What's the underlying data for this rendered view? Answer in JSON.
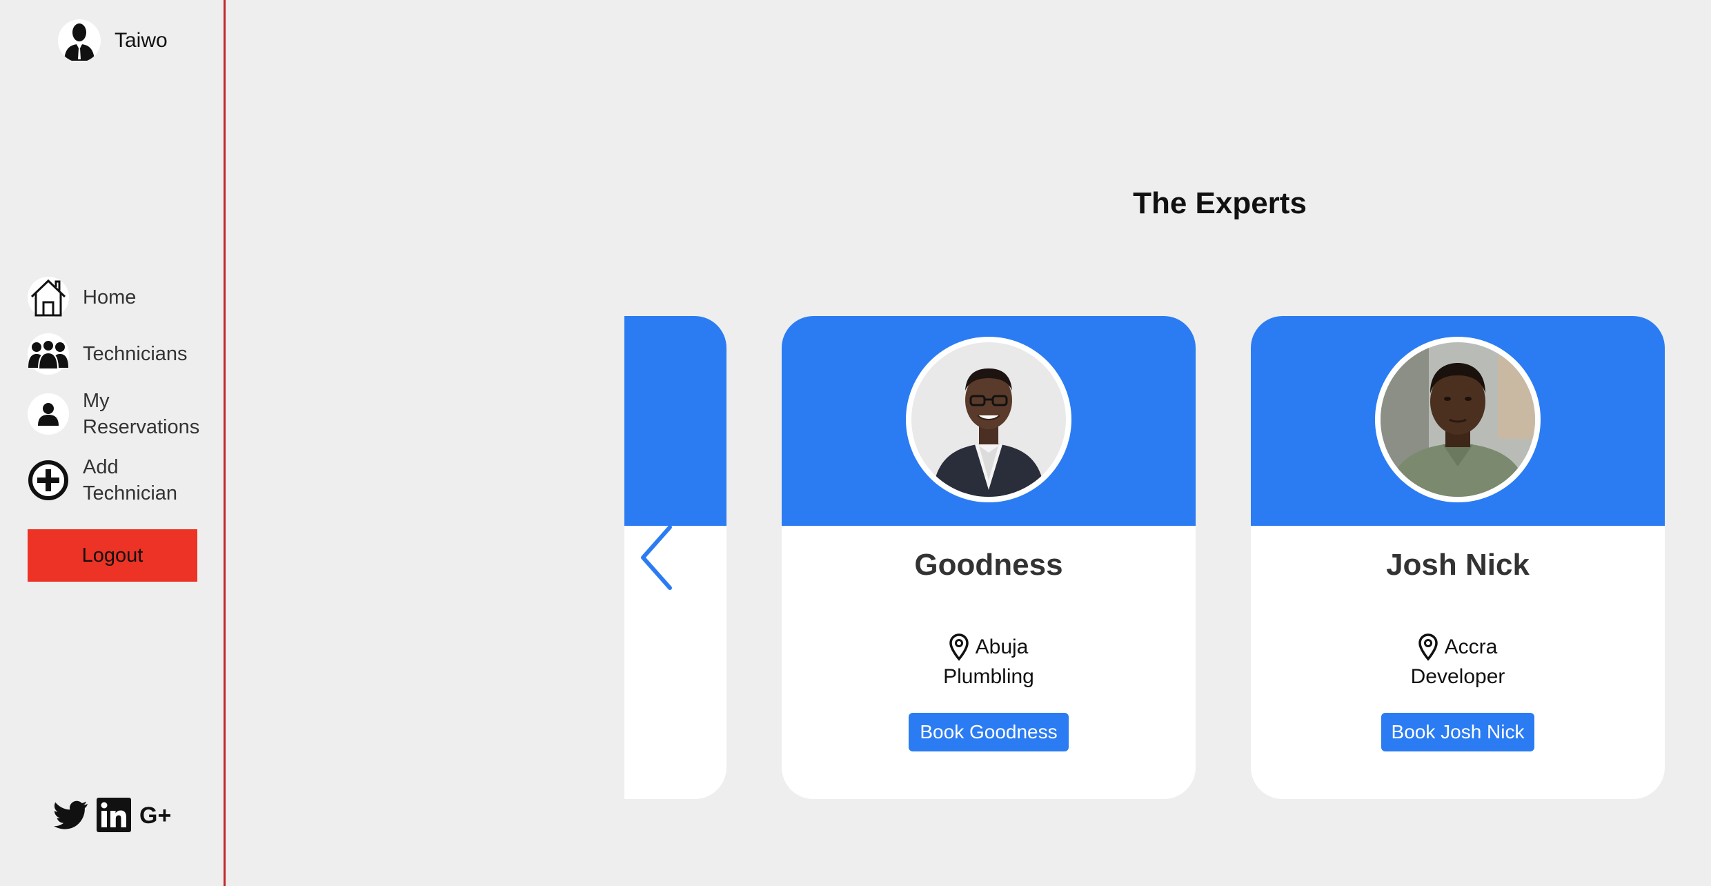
{
  "user": {
    "name": "Taiwo"
  },
  "nav": {
    "items": [
      {
        "label": "Home",
        "icon": "home-icon"
      },
      {
        "label": "Technicians",
        "icon": "group-icon"
      },
      {
        "label": "My\nReservations",
        "icon": "person-icon"
      },
      {
        "label": "Add\nTechnician",
        "icon": "plus-circle-icon"
      }
    ],
    "logout_label": "Logout"
  },
  "social": [
    "twitter-icon",
    "linkedin-icon",
    "google-plus-icon"
  ],
  "main": {
    "title": "The Experts"
  },
  "technicians": [
    {
      "name": "Goodness",
      "location": "Abuja",
      "specialty": "Plumbling",
      "book_label": "Book Goodness"
    },
    {
      "name": "Josh Nick",
      "location": "Accra",
      "specialty": "Developer",
      "book_label": "Book Josh Nick"
    }
  ],
  "colors": {
    "accent": "#2b7cf3",
    "logout": "#ec3325",
    "divider": "#c0282c",
    "background": "#eeeeee"
  }
}
